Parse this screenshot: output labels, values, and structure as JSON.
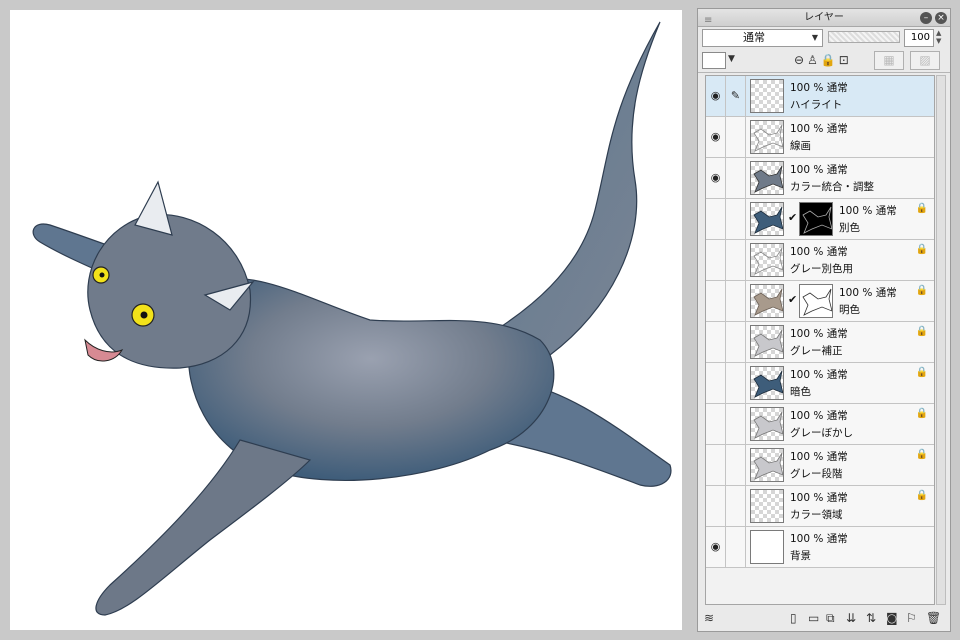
{
  "panel": {
    "title": "レイヤー",
    "blend_mode": "通常",
    "opacity": "100"
  },
  "layers": [
    {
      "percent": "100 %",
      "blend": "通常",
      "name": "ハイライト",
      "visible": true,
      "selected": true,
      "pen": true,
      "locked": false,
      "mask": null,
      "thumb": "empty"
    },
    {
      "percent": "100 %",
      "blend": "通常",
      "name": "線画",
      "visible": true,
      "selected": false,
      "pen": false,
      "locked": false,
      "mask": null,
      "thumb": "lines"
    },
    {
      "percent": "100 %",
      "blend": "通常",
      "name": "カラー統合・調整",
      "visible": true,
      "selected": false,
      "pen": false,
      "locked": false,
      "mask": null,
      "thumb": "cat-gray"
    },
    {
      "percent": "100 %",
      "blend": "通常",
      "name": "別色",
      "visible": false,
      "selected": false,
      "pen": false,
      "locked": true,
      "mask": "black",
      "thumb": "cat-blue"
    },
    {
      "percent": "100 %",
      "blend": "通常",
      "name": "グレー別色用",
      "visible": false,
      "selected": false,
      "pen": false,
      "locked": true,
      "mask": null,
      "thumb": "lines"
    },
    {
      "percent": "100 %",
      "blend": "通常",
      "name": "明色",
      "visible": false,
      "selected": false,
      "pen": false,
      "locked": true,
      "mask": "white",
      "thumb": "tan"
    },
    {
      "percent": "100 %",
      "blend": "通常",
      "name": "グレー補正",
      "visible": false,
      "selected": false,
      "pen": false,
      "locked": true,
      "mask": null,
      "thumb": "cat-light"
    },
    {
      "percent": "100 %",
      "blend": "通常",
      "name": "暗色",
      "visible": false,
      "selected": false,
      "pen": false,
      "locked": true,
      "mask": null,
      "thumb": "cat-blue"
    },
    {
      "percent": "100 %",
      "blend": "通常",
      "name": "グレーぼかし",
      "visible": false,
      "selected": false,
      "pen": false,
      "locked": true,
      "mask": null,
      "thumb": "cat-light"
    },
    {
      "percent": "100 %",
      "blend": "通常",
      "name": "グレー段階",
      "visible": false,
      "selected": false,
      "pen": false,
      "locked": true,
      "mask": null,
      "thumb": "cat-light"
    },
    {
      "percent": "100 %",
      "blend": "通常",
      "name": "カラー領域",
      "visible": false,
      "selected": false,
      "pen": false,
      "locked": true,
      "mask": null,
      "thumb": "empty"
    },
    {
      "percent": "100 %",
      "blend": "通常",
      "name": "背景",
      "visible": true,
      "selected": false,
      "pen": false,
      "locked": false,
      "mask": null,
      "thumb": "white"
    }
  ],
  "colors": {
    "cat_body": "#6f7a89",
    "cat_shadow": "#3e5d7a",
    "cat_highlight": "#a9aebc",
    "eye": "#f2e21a",
    "selected_row": "#d8e9f5"
  }
}
